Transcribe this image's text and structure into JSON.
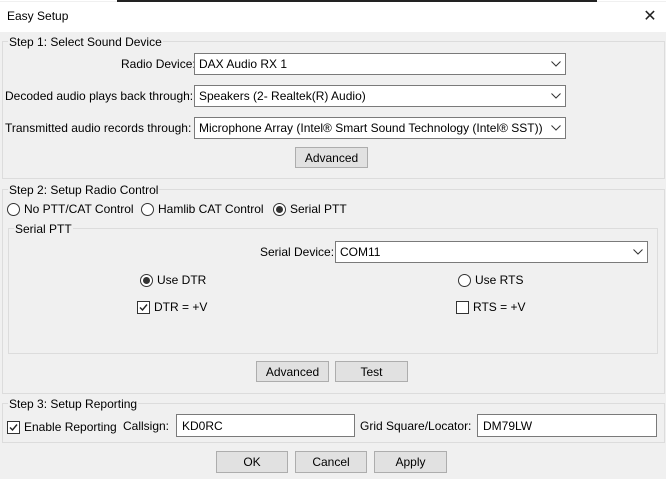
{
  "window": {
    "title": "Easy Setup"
  },
  "step1": {
    "title": "Step 1: Select Sound Device",
    "radio_device_label": "Radio Device:",
    "radio_device_value": "DAX Audio RX 1",
    "playback_label": "Decoded audio plays back through:",
    "playback_value": "Speakers (2- Realtek(R) Audio)",
    "record_label": "Transmitted audio records through:",
    "record_value": "Microphone Array (Intel® Smart Sound Technology (Intel® SST))",
    "advanced_label": "Advanced"
  },
  "step2": {
    "title": "Step 2: Setup Radio Control",
    "options": [
      {
        "label": "No PTT/CAT Control",
        "selected": false
      },
      {
        "label": "Hamlib CAT Control",
        "selected": false
      },
      {
        "label": "Serial PTT",
        "selected": true
      }
    ],
    "serial_ptt": {
      "title": "Serial PTT",
      "device_label": "Serial Device:",
      "device_value": "COM11",
      "use_dtr_label": "Use DTR",
      "use_dtr_selected": true,
      "use_rts_label": "Use RTS",
      "use_rts_selected": false,
      "dtr_label": "DTR = +V",
      "dtr_checked": true,
      "rts_label": "RTS = +V",
      "rts_checked": false
    },
    "advanced_label": "Advanced",
    "test_label": "Test"
  },
  "step3": {
    "title": "Step 3: Setup Reporting",
    "enable_label": "Enable Reporting",
    "enable_checked": true,
    "callsign_label": "Callsign:",
    "callsign_value": "KD0RC",
    "grid_label": "Grid Square/Locator:",
    "grid_value": "DM79LW"
  },
  "footer": {
    "ok_label": "OK",
    "cancel_label": "Cancel",
    "apply_label": "Apply"
  }
}
